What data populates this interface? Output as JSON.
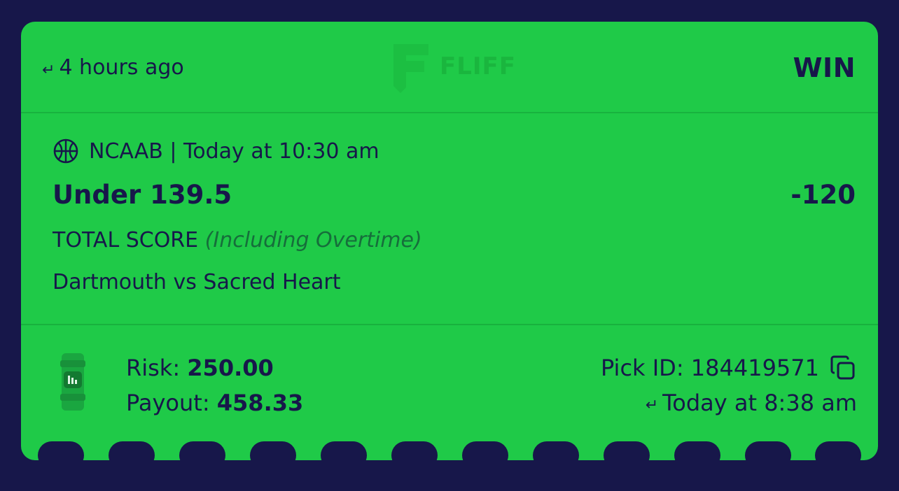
{
  "header": {
    "time_ago": "4 hours ago",
    "result": "WIN",
    "watermark": "FLIFF"
  },
  "event": {
    "league_line": "NCAAB | Today at 10:30 am",
    "selection": "Under 139.5",
    "odds": "-120",
    "market": "TOTAL SCORE",
    "market_note": "(Including Overtime)",
    "matchup": "Dartmouth vs Sacred Heart"
  },
  "stakes": {
    "risk_label": "Risk:",
    "risk_value": "250.00",
    "payout_label": "Payout:",
    "payout_value": "458.33"
  },
  "pick": {
    "id_label": "Pick ID:",
    "id_value": "184419571",
    "placed_at": "Today at 8:38 am"
  },
  "icons": {
    "sport": "basketball-icon",
    "currency": "coin-icon",
    "copy": "copy-icon",
    "return": "return-arrow-icon"
  },
  "colors": {
    "background": "#17174a",
    "card": "#1fca48",
    "text": "#17174a"
  }
}
